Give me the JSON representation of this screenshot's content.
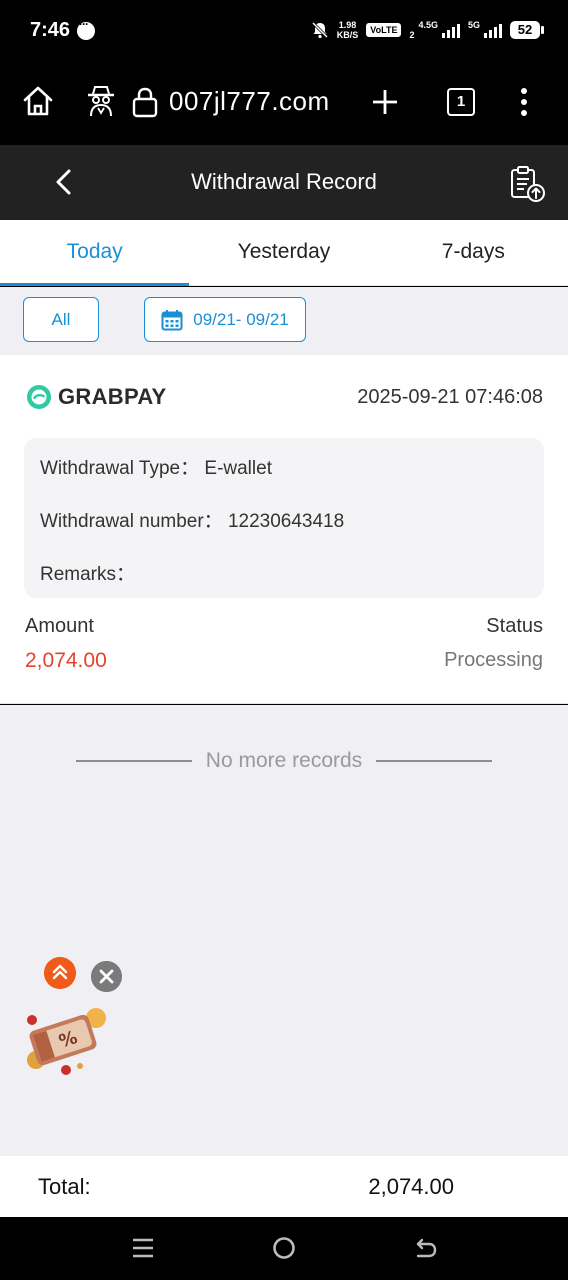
{
  "status_bar": {
    "time": "7:46",
    "net_speed_value": "1.98",
    "net_speed_unit": "KB/S",
    "volte": "VoLTE",
    "volte_sim": "2",
    "network_1": "4.5G",
    "network_2": "5G",
    "battery": "52"
  },
  "browser": {
    "url": "007jl777.com",
    "tab_count": "1"
  },
  "header": {
    "title": "Withdrawal Record"
  },
  "tabs": [
    {
      "label": "Today",
      "active": true
    },
    {
      "label": "Yesterday",
      "active": false
    },
    {
      "label": "7-days",
      "active": false
    }
  ],
  "filters": {
    "type_label": "All",
    "date_range": "09/21- 09/21"
  },
  "record": {
    "brand": "GRABPAY",
    "datetime": "2025-09-21 07:46:08",
    "withdrawal_type_label": "Withdrawal Type：",
    "withdrawal_type_value": "E-wallet",
    "withdrawal_number_label": "Withdrawal number：",
    "withdrawal_number_value": "12230643418",
    "remarks_label": "Remarks：",
    "remarks_value": "",
    "amount_label": "Amount",
    "amount_value": "2,074.00",
    "status_label": "Status",
    "status_value": "Processing"
  },
  "list_end_text": "No more records",
  "footer": {
    "total_label": "Total:",
    "total_value": "2,074.00"
  },
  "colors": {
    "accent": "#1b8fd6",
    "amount": "#e5432d",
    "header_bg": "#222222",
    "page_bg": "#f0eff4"
  }
}
